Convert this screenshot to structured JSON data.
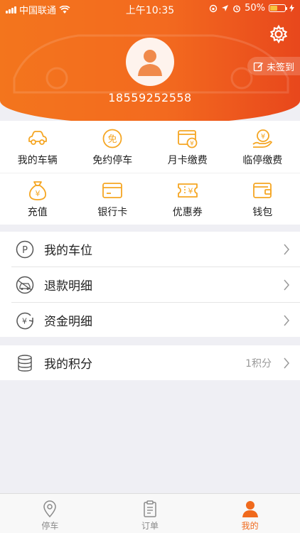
{
  "status_bar": {
    "carrier": "中国联通",
    "time": "上午10:35",
    "battery": "50%",
    "battery_level": 0.5
  },
  "header": {
    "phone": "18559252558",
    "signin_label": "未签到"
  },
  "grid": [
    {
      "label": "我的车辆",
      "icon": "car-icon"
    },
    {
      "label": "免约停车",
      "icon": "free-parking-icon"
    },
    {
      "label": "月卡缴费",
      "icon": "monthly-card-icon"
    },
    {
      "label": "临停缴费",
      "icon": "temp-parking-pay-icon"
    },
    {
      "label": "充值",
      "icon": "money-bag-icon"
    },
    {
      "label": "银行卡",
      "icon": "bank-card-icon"
    },
    {
      "label": "优惠券",
      "icon": "coupon-icon"
    },
    {
      "label": "钱包",
      "icon": "wallet-icon"
    }
  ],
  "list": [
    {
      "label": "我的车位",
      "icon": "parking-p-icon"
    },
    {
      "label": "退款明细",
      "icon": "refund-icon"
    },
    {
      "label": "资金明细",
      "icon": "funds-icon"
    }
  ],
  "points": {
    "label": "我的积分",
    "value": "1积分",
    "icon": "coins-stack-icon"
  },
  "tabbar": [
    {
      "label": "停车",
      "icon": "location-pin-icon",
      "active": false
    },
    {
      "label": "订单",
      "icon": "clipboard-icon",
      "active": false
    },
    {
      "label": "我的",
      "icon": "person-icon",
      "active": true
    }
  ],
  "colors": {
    "accent": "#f06a1d",
    "header_start": "#f3751d",
    "header_end": "#e8471c",
    "icon_orange": "#f5a623"
  }
}
